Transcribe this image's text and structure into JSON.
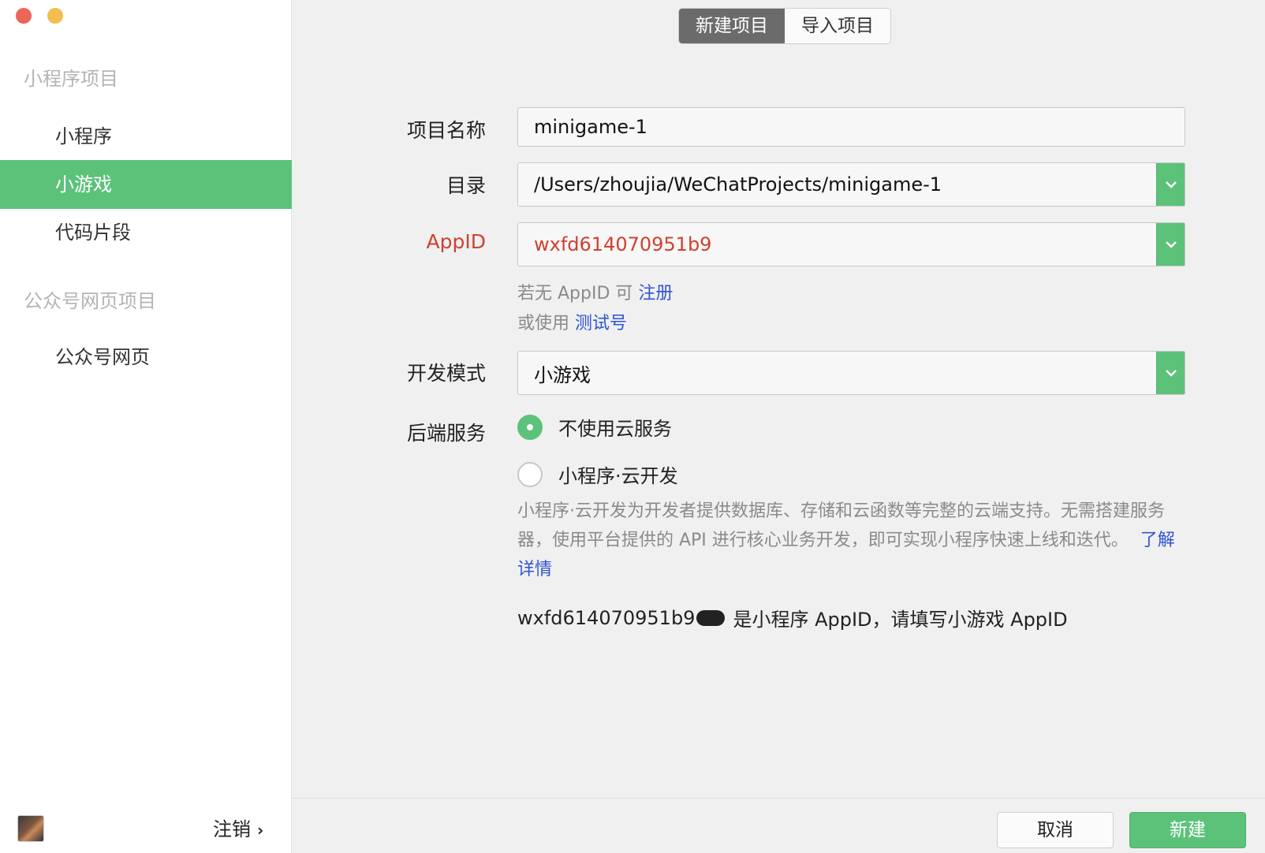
{
  "sidebar": {
    "sections": [
      {
        "title": "小程序项目",
        "items": [
          "小程序",
          "小游戏",
          "代码片段"
        ]
      },
      {
        "title": "公众号网页项目",
        "items": [
          "公众号网页"
        ]
      }
    ],
    "active_item": "小游戏",
    "logout_label": "注销",
    "logout_chevron": "›"
  },
  "tabs": {
    "new_project": "新建项目",
    "import_project": "导入项目",
    "active": "新建项目"
  },
  "form": {
    "name": {
      "label": "项目名称",
      "value": "minigame-1"
    },
    "directory": {
      "label": "目录",
      "value": "/Users/zhoujia/WeChatProjects/minigame-1"
    },
    "appid": {
      "label": "AppID",
      "value": "wxfd614070951b9"
    },
    "appid_hint": {
      "prefix": "若无 AppID 可",
      "register_link": "注册",
      "or_use": "或使用",
      "test_link": "测试号"
    },
    "mode": {
      "label": "开发模式",
      "value": "小游戏"
    },
    "backend": {
      "label": "后端服务",
      "option_none": "不使用云服务",
      "option_cloud": "小程序·云开发",
      "selected": "不使用云服务",
      "description": "小程序·云开发为开发者提供数据库、存储和云函数等完整的云端支持。无需搭建服务器，使用平台提供的 API 进行核心业务开发，即可实现小程序快速上线和迭代。",
      "learn_more": "了解详情"
    },
    "notice": {
      "appid_prefix": "wxfd614070951b9",
      "message": "是小程序 AppID，请填写小游戏 AppID"
    }
  },
  "footer": {
    "cancel": "取消",
    "create": "新建"
  },
  "colors": {
    "accent_green": "#5cc27a",
    "error_red": "#d0402f",
    "link_blue": "#2f55d4"
  }
}
